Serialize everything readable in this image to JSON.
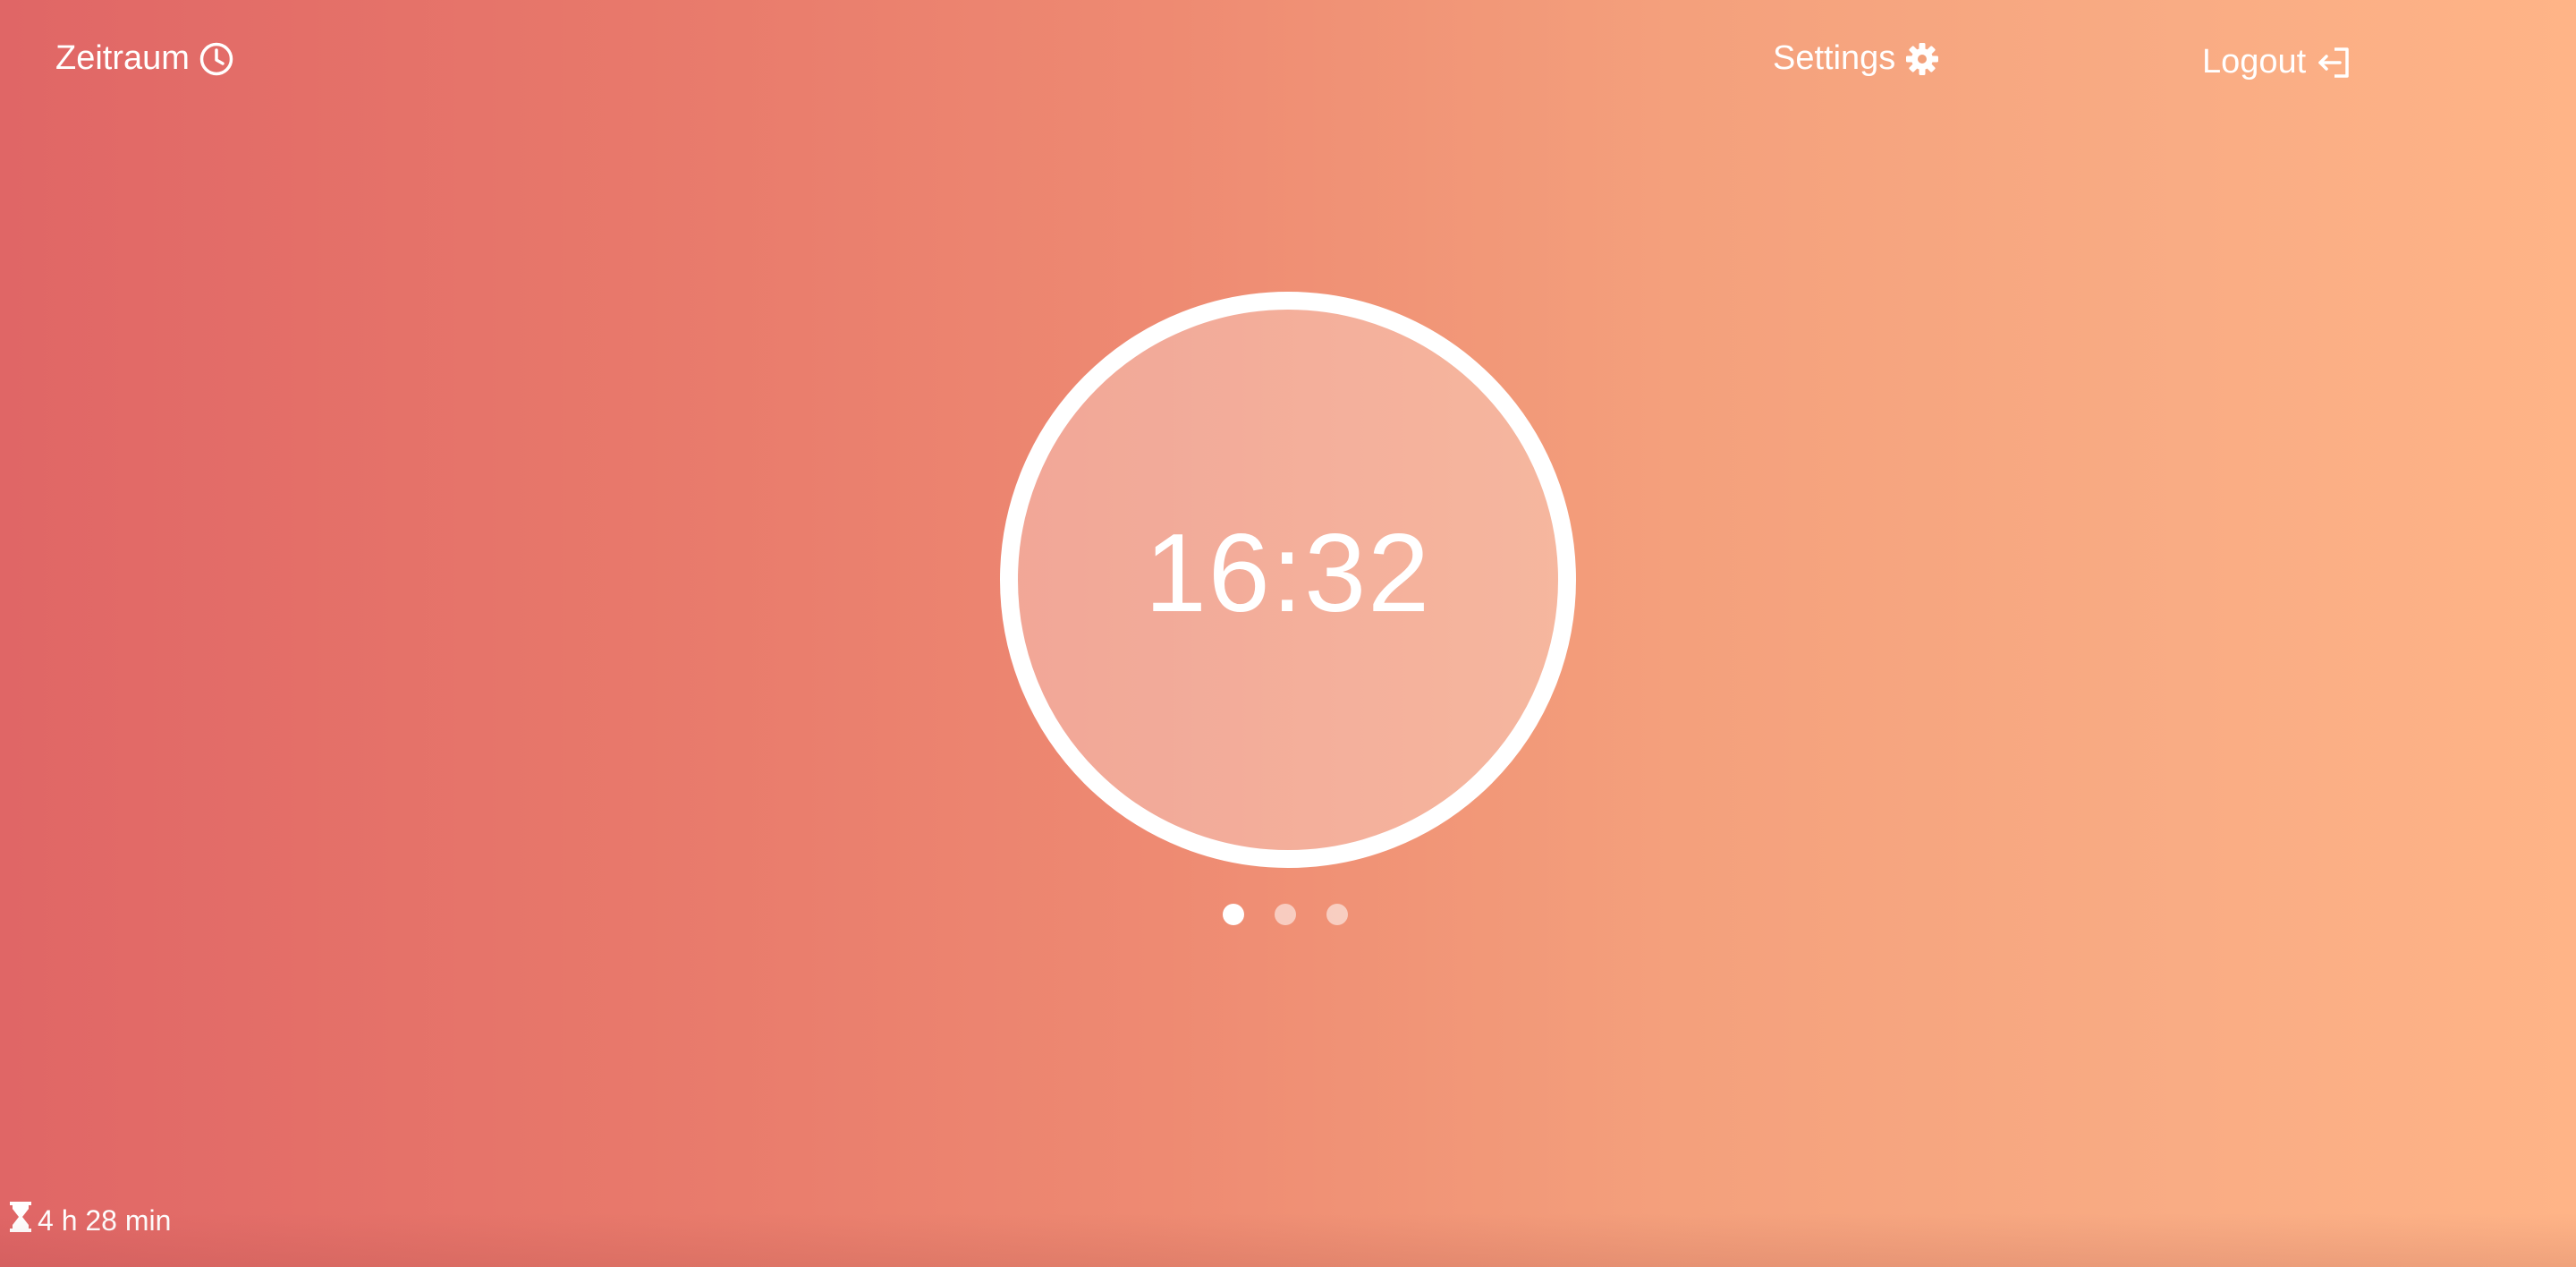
{
  "nav": {
    "brand_label": "Zeitraum",
    "brand_icon": "clock-icon",
    "settings_label": "Settings",
    "settings_icon": "gear-icon",
    "logout_label": "Logout",
    "logout_icon": "logout-icon"
  },
  "timer": {
    "time": "16:32"
  },
  "pager": {
    "count": 3,
    "active_index": 0
  },
  "footer": {
    "remaining_icon": "hourglass-icon",
    "remaining_text": "4 h 28 min"
  },
  "colors": {
    "gradient_start": "#e06666",
    "gradient_end": "#ffb487",
    "foreground": "#ffffff"
  }
}
